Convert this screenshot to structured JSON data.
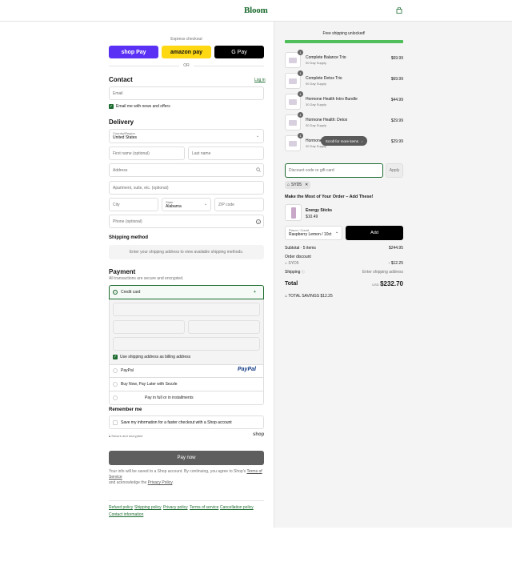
{
  "header": {
    "brand": "Bloom",
    "cart_icon": "shopping-bag-icon"
  },
  "express": {
    "label": "Express checkout",
    "shop_pay": "shop Pay",
    "amazon_pay": "amazon pay",
    "gpay": "G Pay",
    "or": "OR"
  },
  "contact": {
    "title": "Contact",
    "login": "Log in",
    "email_placeholder": "Email",
    "news_label": "Email me with news and offers"
  },
  "delivery": {
    "title": "Delivery",
    "country_label": "Country/Region",
    "country_value": "United States",
    "first_name": "First name (optional)",
    "last_name": "Last name",
    "address": "Address",
    "apartment": "Apartment, suite, etc. (optional)",
    "city": "City",
    "state_label": "State",
    "state_value": "Alabama",
    "zip": "ZIP code",
    "phone": "Phone (optional)"
  },
  "shipping": {
    "title": "Shipping method",
    "note": "Enter your shipping address to view available shipping methods."
  },
  "payment": {
    "title": "Payment",
    "subtitle": "All transactions are secure and encrypted.",
    "credit_card": "Credit card",
    "billing_same": "Use shipping address as billing address",
    "paypal": "PayPal",
    "paypal_logo": "PayPal",
    "sezzle": "Buy Now, Pay Later with Sezzle",
    "installments": "Pay in full or in installments"
  },
  "remember": {
    "title": "Remember me",
    "save_info": "Save my information for a faster checkout with a Shop account",
    "secure": "Secure and encrypted",
    "shop_logo": "shop"
  },
  "pay_now": "Pay now",
  "legal": {
    "text_a": "Your info will be saved to a Shop account. By continuing, you agree to Shop's ",
    "terms": "Terms of Service",
    "text_b": "and acknowledge the ",
    "privacy": "Privacy Policy",
    "text_c": "."
  },
  "footer_links": [
    "Refund policy",
    "Shipping policy",
    "Privacy policy",
    "Terms of service",
    "Cancellation policy",
    "Contact information"
  ],
  "summary": {
    "free_shipping": "Free shipping unlocked!",
    "progress": 1.0,
    "items": [
      {
        "name": "Complete Balance Trio",
        "sub": "90 Day Supply",
        "price": "$69.99",
        "qty": "1"
      },
      {
        "name": "Complete Detox Trio",
        "sub": "90 Day Supply",
        "price": "$69.99",
        "qty": "1"
      },
      {
        "name": "Hormone Health Intro Bundle",
        "sub": "30 Day Supply",
        "price": "$44.99",
        "qty": "1"
      },
      {
        "name": "Hormone Health: Detox",
        "sub": "30 Day Supply",
        "price": "$29.99",
        "qty": "1"
      },
      {
        "name": "Hormone",
        "sub": "30 Day Supply",
        "price": "$29.99",
        "qty": "1"
      }
    ],
    "scroll_hint": "Scroll for more items",
    "discount_placeholder": "Discount code or gift card",
    "apply": "Apply",
    "code_tag": "SYD5",
    "upsell_title": "Make the Most of Your Order – Add These!",
    "upsell_name": "Energy Sticks",
    "upsell_price": "$10.49",
    "flavor_label": "Flavor / Count",
    "flavor_value": "Raspberry Lemon / 10ct",
    "add": "Add",
    "subtotal_label": "Subtotal · 5 items",
    "subtotal_value": "$244.95",
    "order_discount": "Order discount",
    "discount_code": "SYD5",
    "discount_value": "- $12.25",
    "shipping_label": "Shipping",
    "shipping_value": "Enter shipping address",
    "total_label": "Total",
    "currency": "USD",
    "total_value": "$232.70",
    "savings_label": "TOTAL SAVINGS",
    "savings_value": "$12.25"
  },
  "colors": {
    "brand": "#1c6b2f",
    "shop_pay": "#5a31f4",
    "amazon": "#ffd814",
    "pay_now": "#5e5e5e"
  }
}
